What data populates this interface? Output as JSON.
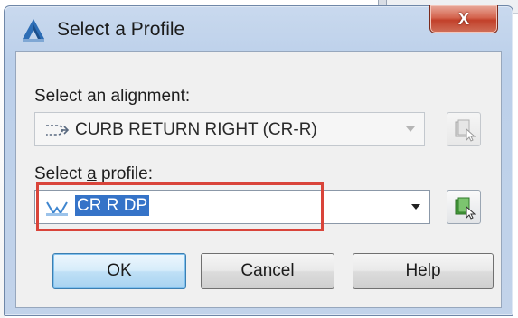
{
  "dialog": {
    "title": "Select a Profile",
    "close_label": "X",
    "app_icon": "civil3d-app-icon"
  },
  "alignment": {
    "label": "Select an alignment:",
    "value": "CURB RETURN RIGHT (CR-R)",
    "icon": "alignment-icon",
    "enabled": false
  },
  "profile": {
    "label_prefix": "Select ",
    "label_mnemonic": "a",
    "label_suffix": " profile:",
    "value": "CR R DP",
    "icon": "profile-icon",
    "selected": true
  },
  "buttons": {
    "ok": "OK",
    "cancel": "Cancel",
    "help": "Help"
  },
  "colors": {
    "highlight": "#d9443a",
    "selection": "#3573c8",
    "close": "#c2402a"
  }
}
